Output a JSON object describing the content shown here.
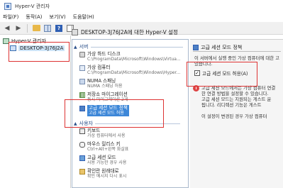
{
  "window": {
    "title": "Hyper-V 관리자"
  },
  "menu": [
    "파일(F)",
    "동작(A)",
    "보기(V)",
    "도움말(H)"
  ],
  "tree": {
    "root": "Hyper-V 관리자",
    "host": "DESKTOP-3J76J2A"
  },
  "dialog": {
    "title": "DESKTOP-3J76J2A에 대한 Hyper-V 설정"
  },
  "sections": {
    "server": "서버",
    "user": "사용자"
  },
  "server_items": [
    {
      "label": "가상 하드 디스크",
      "sub": "C:\\ProgramData\\Microsoft\\Windows\\Virtua..."
    },
    {
      "label": "가상 컴퓨터",
      "sub": "C:\\ProgramData\\Microsoft\\Windows\\Hyper..."
    },
    {
      "label": "NUMA 스패닝",
      "sub": "NUMA 스패닝 허용"
    },
    {
      "label": "저장소 마이그레이션",
      "sub": "동시 마이그레이션 2개"
    },
    {
      "label": "고급 세션 모드 정책",
      "sub": "고급 세션 모드 허용"
    }
  ],
  "user_items": [
    {
      "label": "키보드",
      "sub": "가상 컴퓨터에서 사용"
    },
    {
      "label": "마우스 릴리스 키",
      "sub": "Ctrl+Alt+왼쪽 화살표"
    },
    {
      "label": "고급 세션 모드",
      "sub": "사용 가능한 경우 사용"
    },
    {
      "label": "확인란 원래대로",
      "sub": "확인 메시지 다시 표시"
    }
  ],
  "detail": {
    "header": "고급 세션 모드 정책",
    "desc_line1": "이 서버에서 실행 중인 가상 컴퓨터에 대한 고",
    "desc_line2": "있습니다.",
    "checkbox_label": "고급 세션 모드 허용(A)",
    "checkbox_checked": "✓",
    "note_lines": [
      "고급 세션 모드에서는 가상 컴퓨터 연결",
      "한 연결 방법을 설정할 수 있습니다.",
      "고급 세션 모드는 지원되는 게스트 운",
      "됩니다. 리디렉션 기능은 게스트",
      "",
      "이 설정이 변경된 경우 가상 컴퓨터"
    ]
  }
}
